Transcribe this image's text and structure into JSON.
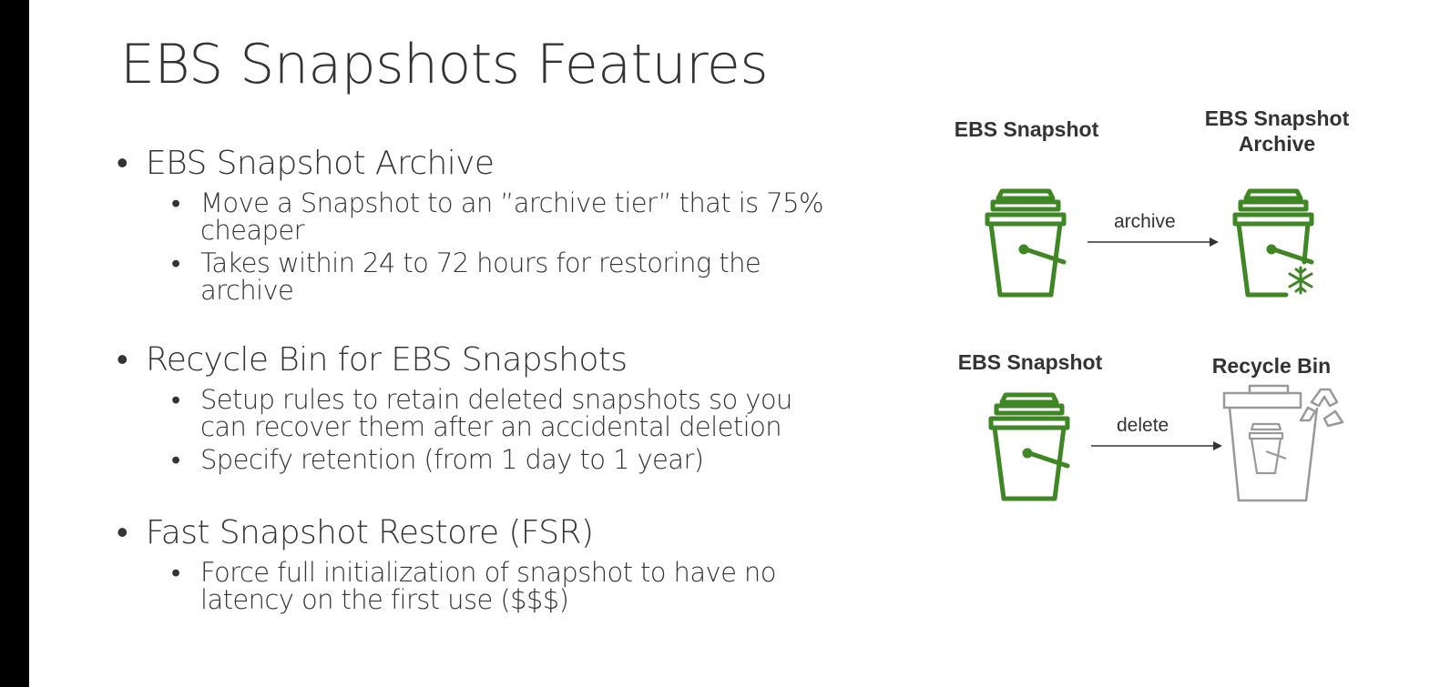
{
  "title": "EBS Snapshots Features",
  "sections": [
    {
      "heading": "EBS Snapshot Archive",
      "items": [
        "Move a Snapshot to an ”archive tier” that is 75% cheaper",
        "Takes within 24 to 72 hours for restoring the archive"
      ]
    },
    {
      "heading": "Recycle Bin for EBS Snapshots",
      "items": [
        "Setup rules to retain deleted snapshots so you can recover them after an accidental deletion",
        "Specify retention (from 1 day to 1 year)"
      ]
    },
    {
      "heading": "Fast Snapshot Restore (FSR)",
      "items": [
        "Force full initialization of snapshot to have no latency on the first use ($$$)"
      ]
    }
  ],
  "diagram": {
    "top": {
      "source_label": "EBS Snapshot",
      "target_label": "EBS Snapshot Archive",
      "arrow_label": "archive"
    },
    "bottom": {
      "source_label": "EBS Snapshot",
      "target_label": "Recycle Bin",
      "arrow_label": "delete"
    }
  },
  "colors": {
    "bucket_green": "#3f8624",
    "recycle_gray": "#999999",
    "text": "#333333"
  },
  "icons": [
    "bucket-icon",
    "snowflake-icon",
    "recycle-bin-icon",
    "recycle-symbol-icon",
    "arrow-right-icon"
  ]
}
